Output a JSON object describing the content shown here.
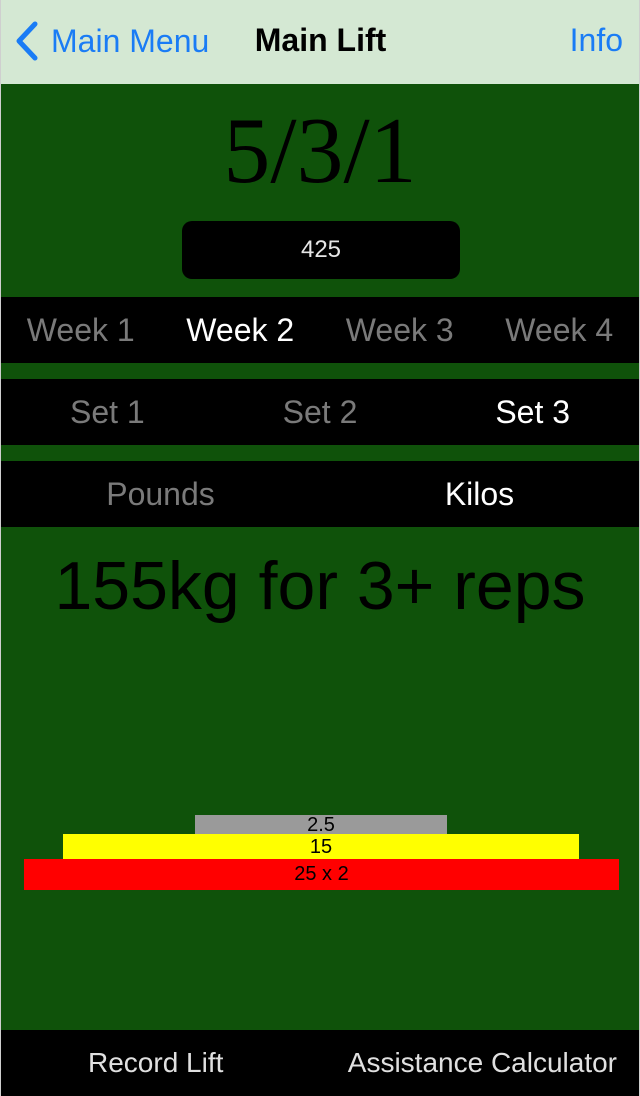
{
  "nav": {
    "back_label": "Main Menu",
    "title": "Main Lift",
    "info_label": "Info"
  },
  "program": {
    "title": "5/3/1",
    "training_max": "425"
  },
  "weeks": {
    "items": [
      "Week 1",
      "Week 2",
      "Week 3",
      "Week 4"
    ],
    "selected": "Week 2"
  },
  "sets": {
    "items": [
      "Set 1",
      "Set 2",
      "Set 3"
    ],
    "selected": "Set 3"
  },
  "units": {
    "items": [
      "Pounds",
      "Kilos"
    ],
    "selected": "Kilos"
  },
  "result": {
    "text": "155kg for 3+ reps"
  },
  "plates": [
    {
      "label": "2.5",
      "color": "#9a9a9a"
    },
    {
      "label": "15",
      "color": "#ffff00"
    },
    {
      "label": "25 x 2",
      "color": "#ff0000"
    }
  ],
  "bottom": {
    "record_label": "Record Lift",
    "assist_label": "Assistance Calculator"
  },
  "colors": {
    "background": "#0f520a",
    "navbar": "#d4e8d3",
    "accent": "#1a7cf5"
  },
  "icons": {
    "back": "chevron-left-icon"
  }
}
